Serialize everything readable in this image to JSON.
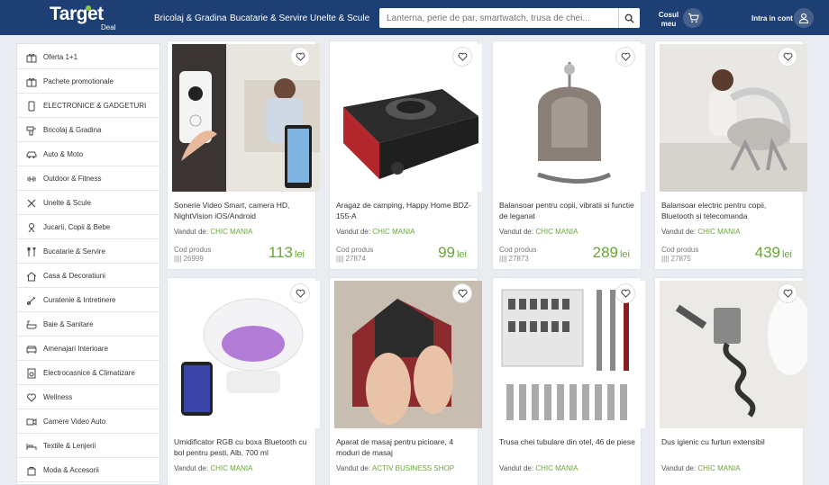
{
  "header": {
    "logo_main": "Target",
    "logo_sub": "Deal",
    "nav": [
      "Bricolaj & Gradina",
      "Bucatarie & Servire",
      "Unelte & Scule"
    ],
    "search_placeholder": "Lanterna, perie de par, smartwatch, trusa de chei...",
    "cart_label_1": "Cosul",
    "cart_label_2": "meu",
    "login_label": "Intra in cont",
    "icons": [
      "search-icon",
      "cart-icon",
      "user-icon"
    ]
  },
  "sidebar": {
    "items": [
      {
        "label": "Oferta 1+1",
        "icon": "gift-icon"
      },
      {
        "label": "Pachete promotionale",
        "icon": "gift-icon"
      },
      {
        "label": "ELECTRONICE & GADGETURI",
        "icon": "phone-icon"
      },
      {
        "label": "Bricolaj & Gradina",
        "icon": "drill-icon"
      },
      {
        "label": "Auto & Moto",
        "icon": "car-icon"
      },
      {
        "label": "Outdoor & Fitness",
        "icon": "dumbbell-icon"
      },
      {
        "label": "Unelte & Scule",
        "icon": "tools-icon"
      },
      {
        "label": "Jucarii, Copii & Bebe",
        "icon": "toy-icon"
      },
      {
        "label": "Bucatarie & Servire",
        "icon": "cutlery-icon"
      },
      {
        "label": "Casa & Decoratiuni",
        "icon": "home-icon"
      },
      {
        "label": "Curatenie & Intretinere",
        "icon": "spray-icon"
      },
      {
        "label": "Baie & Sanitare",
        "icon": "bath-icon"
      },
      {
        "label": "Amenajari Interioare",
        "icon": "sofa-icon"
      },
      {
        "label": "Electrocasnice & Climatizare",
        "icon": "appliance-icon"
      },
      {
        "label": "Wellness",
        "icon": "heart-hand-icon"
      },
      {
        "label": "Camere Video Auto",
        "icon": "camera-icon"
      },
      {
        "label": "Textile & Lenjerii",
        "icon": "bed-icon"
      },
      {
        "label": "Moda & Accesorii",
        "icon": "bag-icon"
      }
    ]
  },
  "seller_prefix": "Vandut de:",
  "code_label": "Cod produs",
  "currency": "lei",
  "products": [
    {
      "title": "Sonerie Video Smart, camera HD, NightVision iOS/Android",
      "seller": "CHIC MANIA",
      "code": "26999",
      "price": "113",
      "image": "video-doorbell-image"
    },
    {
      "title": "Aragaz de camping, Happy Home BDZ-155-A",
      "seller": "CHIC MANIA",
      "code": "27874",
      "price": "99",
      "image": "camping-stove-image"
    },
    {
      "title": "Balansoar pentru copii, vibratii si functie de leganat",
      "seller": "CHIC MANIA",
      "code": "27873",
      "price": "289",
      "image": "baby-bouncer-image"
    },
    {
      "title": "Balansoar electric pentru copii, Bluetooth si telecomanda",
      "seller": "CHIC MANIA",
      "code": "27875",
      "price": "439",
      "image": "electric-swing-image"
    },
    {
      "title": "Umidificator RGB cu boxa Bluetooth cu bol pentru pesti, Alb, 700 ml",
      "seller": "CHIC MANIA",
      "code": "",
      "price": "",
      "image": "humidifier-image"
    },
    {
      "title": "Aparat de masaj pentru picioare, 4 moduri de masaj",
      "seller": "ACTIV BUSINESS SHOP",
      "code": "",
      "price": "",
      "image": "foot-massager-image"
    },
    {
      "title": "Trusa chei tubulare din otel, 46 de piese",
      "seller": "CHIC MANIA",
      "code": "",
      "price": "",
      "image": "socket-set-image"
    },
    {
      "title": "Dus igienic cu furtun extensibil",
      "seller": "CHIC MANIA",
      "code": "",
      "price": "",
      "image": "bidet-shower-image"
    }
  ]
}
